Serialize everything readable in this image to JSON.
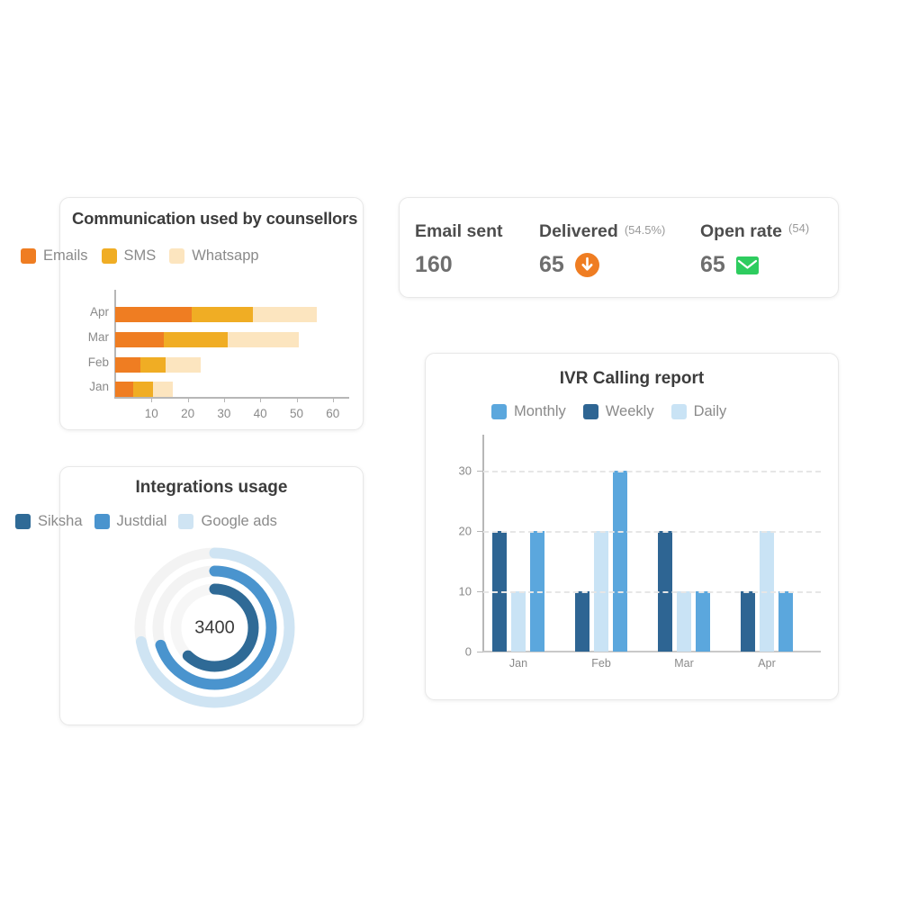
{
  "communication": {
    "title": "Communication used by counsellors",
    "legend": [
      {
        "label": "Emails",
        "color": "#ef7d22"
      },
      {
        "label": "SMS",
        "color": "#f0ad24"
      },
      {
        "label": "Whatsapp",
        "color": "#fce5bf"
      }
    ]
  },
  "integrations": {
    "title": "Integrations usage",
    "center_value": "3400",
    "legend": [
      {
        "label": "Siksha",
        "color": "#2f6a96"
      },
      {
        "label": "Justdial",
        "color": "#4a94ce"
      },
      {
        "label": "Google ads",
        "color": "#cfe4f3"
      }
    ]
  },
  "kpi": {
    "items": [
      {
        "label": "Email sent",
        "sub": "",
        "value": "160",
        "icon": ""
      },
      {
        "label": "Delivered",
        "sub": "(54.5%)",
        "value": "65",
        "icon": "down-arrow-circle-icon"
      },
      {
        "label": "Open rate",
        "sub": "(54)",
        "value": "65",
        "icon": "envelope-icon"
      }
    ],
    "down_icon_color": "#ef7d22",
    "envelope_icon_color": "#2ecc5f"
  },
  "ivr": {
    "title": "IVR Calling report",
    "legend": [
      {
        "label": "Monthly",
        "color": "#5ba7dd"
      },
      {
        "label": "Weekly",
        "color": "#2e6593"
      },
      {
        "label": "Daily",
        "color": "#c9e3f5"
      }
    ]
  },
  "chart_data": [
    {
      "type": "bar",
      "orientation": "horizontal",
      "stacked": true,
      "title": "Communication used by counsellors",
      "categories": [
        "Apr",
        "Mar",
        "Feb",
        "Jan"
      ],
      "series": [
        {
          "name": "Emails",
          "color": "#ef7d22",
          "values": [
            21,
            13.5,
            7,
            5
          ]
        },
        {
          "name": "SMS",
          "color": "#f0ad24",
          "values": [
            17,
            17.5,
            7,
            5.5
          ]
        },
        {
          "name": "Whatsapp",
          "color": "#fce5bf",
          "values": [
            17.5,
            19.5,
            9.5,
            5.5
          ]
        }
      ],
      "totals": [
        55.5,
        50.5,
        23.5,
        16
      ],
      "xlabel": "",
      "ylabel": "",
      "xlim": [
        0,
        66
      ],
      "xticks": [
        10,
        20,
        30,
        40,
        50,
        60
      ],
      "grid": false,
      "legend_position": "top-left"
    },
    {
      "type": "pie",
      "subtype": "radial-bar",
      "title": "Integrations usage",
      "center_label": "3400",
      "categories": [
        "Siksha",
        "Justdial",
        "Google ads"
      ],
      "values": [
        62,
        70,
        72
      ],
      "unit": "percent-of-ring",
      "colors": [
        "#2f6a96",
        "#4a94ce",
        "#cfe4f3"
      ],
      "track_color": "#f1f1f1",
      "legend_position": "top"
    },
    {
      "type": "bar",
      "orientation": "vertical",
      "grouped": true,
      "title": "IVR Calling report",
      "categories": [
        "Jan",
        "Feb",
        "Mar",
        "Apr"
      ],
      "series": [
        {
          "name": "Weekly",
          "color": "#2e6593",
          "values": [
            20,
            10,
            20,
            10
          ]
        },
        {
          "name": "Daily",
          "color": "#c9e3f5",
          "values": [
            10,
            20,
            10,
            20
          ]
        },
        {
          "name": "Monthly",
          "color": "#5ba7dd",
          "values": [
            20,
            30,
            10,
            10
          ]
        }
      ],
      "xlabel": "",
      "ylabel": "",
      "ylim": [
        0,
        36
      ],
      "yticks": [
        0,
        10,
        20,
        30
      ],
      "grid": "horizontal-dashed",
      "legend_position": "top"
    }
  ]
}
